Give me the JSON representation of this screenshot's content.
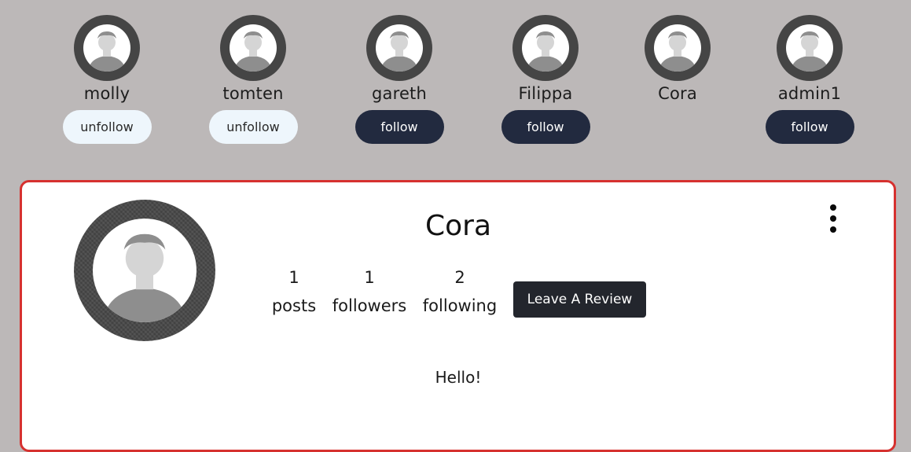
{
  "users": [
    {
      "name": "molly",
      "button": "unfollow",
      "style": "light"
    },
    {
      "name": "tomten",
      "button": "unfollow",
      "style": "light"
    },
    {
      "name": "gareth",
      "button": "follow",
      "style": "dark"
    },
    {
      "name": "Filippa",
      "button": "follow",
      "style": "dark"
    },
    {
      "name": "Cora",
      "button": "",
      "style": "none"
    },
    {
      "name": "admin1",
      "button": "follow",
      "style": "dark"
    }
  ],
  "profile": {
    "name": "Cora",
    "stats": [
      {
        "value": "1",
        "label": "posts"
      },
      {
        "value": "1",
        "label": "followers"
      },
      {
        "value": "2",
        "label": "following"
      }
    ],
    "review_button": "Leave A Review",
    "bio": "Hello!",
    "menu_icon": "kebab-menu-icon"
  },
  "colors": {
    "background": "#bcb8b8",
    "follow_dark": "#222a3f",
    "unfollow_light": "#eef6fc",
    "card_border": "#d6312f"
  }
}
